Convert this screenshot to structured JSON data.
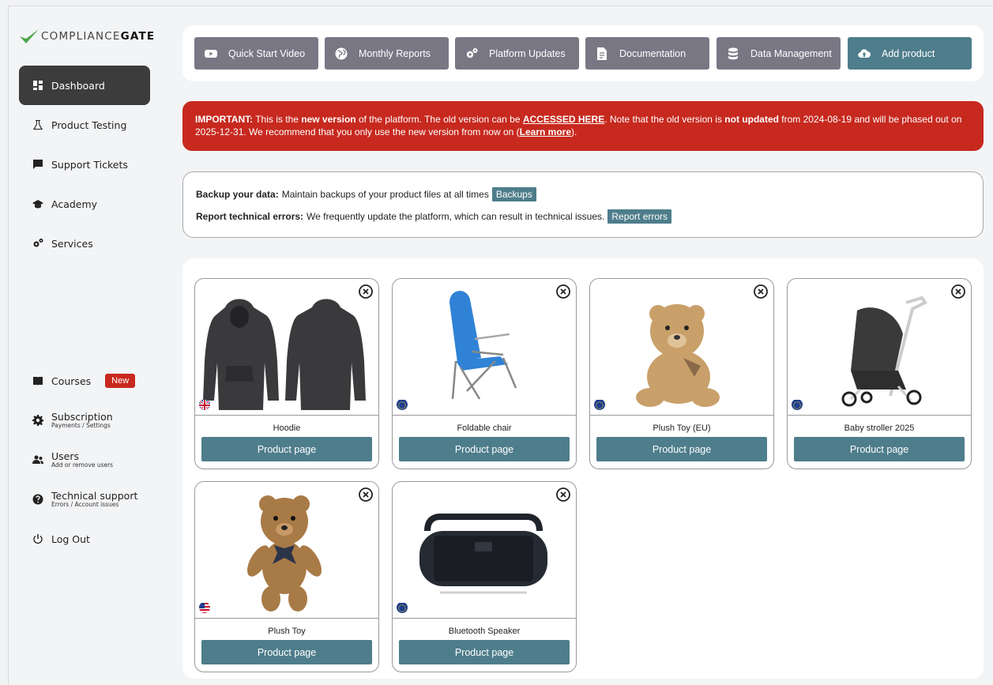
{
  "brand": {
    "name_light": "COMPLIANCE",
    "name_bold": "GATE",
    "check_color": "#4fa64a"
  },
  "sidebar": {
    "items": [
      {
        "label": "Dashboard",
        "icon": "dashboard-icon"
      },
      {
        "label": "Product Testing",
        "icon": "flask-icon"
      },
      {
        "label": "Support Tickets",
        "icon": "chat-icon"
      },
      {
        "label": "Academy",
        "icon": "graduation-cap-icon"
      },
      {
        "label": "Services",
        "icon": "gears-icon"
      }
    ],
    "bottom": [
      {
        "label": "Courses",
        "badge": "New",
        "icon": "book-icon"
      },
      {
        "label": "Subscription",
        "sub": "Payments / Settings",
        "icon": "gear-icon"
      },
      {
        "label": "Users",
        "sub": "Add or remove users",
        "icon": "users-icon"
      },
      {
        "label": "Technical support",
        "sub": "Errors / Account issues",
        "icon": "question-icon"
      },
      {
        "label": "Log Out",
        "icon": "power-icon"
      }
    ]
  },
  "toolbar": {
    "buttons": [
      {
        "label": "Quick Start Video",
        "icon": "youtube-icon"
      },
      {
        "label": "Monthly Reports",
        "icon": "globe-icon"
      },
      {
        "label": "Platform Updates",
        "icon": "gears-icon"
      },
      {
        "label": "Documentation",
        "icon": "document-icon"
      },
      {
        "label": "Data Management",
        "icon": "database-icon"
      },
      {
        "label": "Add product",
        "icon": "cloud-upload-icon"
      }
    ]
  },
  "alert": {
    "important": "IMPORTANT:",
    "t1": " This is the ",
    "new_version": "new version",
    "t2": " of the platform. The old version can be ",
    "accessed_link": "ACCESSED HERE",
    "t3": ". Note that the old version is ",
    "not_updated": "not updated",
    "t4": " from 2024-08-19 and will be phased out on 2025-12-31. We recommend that you only use the new version from now on (",
    "learn_more": "Learn more",
    "t5": ")."
  },
  "info": {
    "backup_title": "Backup your data:",
    "backup_text": "Maintain backups of your product files at all times",
    "backup_button": "Backups",
    "report_title": "Report technical errors:",
    "report_text": "We frequently update the platform, which can result in technical issues.",
    "report_button": "Report errors"
  },
  "products": [
    {
      "name": "Hoodie",
      "button": "Product page",
      "flag": "uk-flag"
    },
    {
      "name": "Foldable chair",
      "button": "Product page",
      "flag": "eu-flag"
    },
    {
      "name": "Plush Toy (EU)",
      "button": "Product page",
      "flag": "eu-flag"
    },
    {
      "name": "Baby stroller 2025",
      "button": "Product page",
      "flag": "eu-flag"
    },
    {
      "name": "Plush Toy",
      "button": "Product page",
      "flag": "us-flag"
    },
    {
      "name": "Bluetooth Speaker",
      "button": "Product page",
      "flag": "eu-flag"
    }
  ],
  "colors": {
    "accent": "#4e7d8b",
    "toolbar_button": "#7a7785",
    "alert": "#c7291f",
    "badge": "#c8281e"
  }
}
